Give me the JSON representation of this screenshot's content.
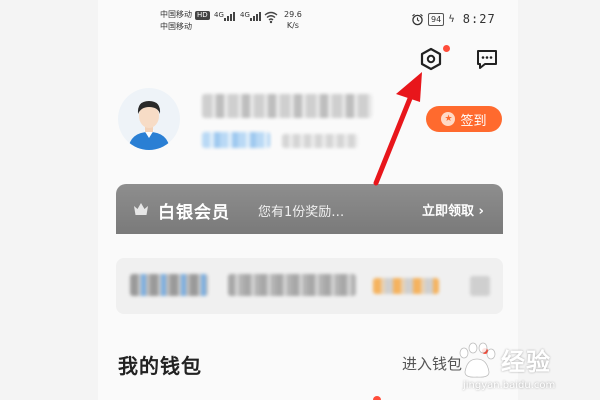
{
  "status_bar": {
    "carrier_1": "中国移动",
    "carrier_2": "中国移动",
    "hd_badge": "HD",
    "net_1": "4G",
    "net_2": "4G",
    "speed_value": "29.6",
    "speed_unit": "K/s",
    "battery": "94",
    "time": "8:27"
  },
  "header": {
    "settings_icon": "hexagon-settings-icon",
    "message_icon": "chat-bubble-icon"
  },
  "profile": {
    "checkin_label": "签到"
  },
  "vip": {
    "title": "白银会员",
    "description": "您有1份奖励…",
    "action": "立即领取"
  },
  "wallet": {
    "title": "我的钱包",
    "link": "进入钱包"
  },
  "watermark": {
    "text": "经验",
    "url": "jingyan.baidu.com"
  },
  "colors": {
    "accent": "#ff6a2e",
    "arrow": "#e8161b",
    "vip_bg": "#858585",
    "dot": "#ff4d3a"
  }
}
